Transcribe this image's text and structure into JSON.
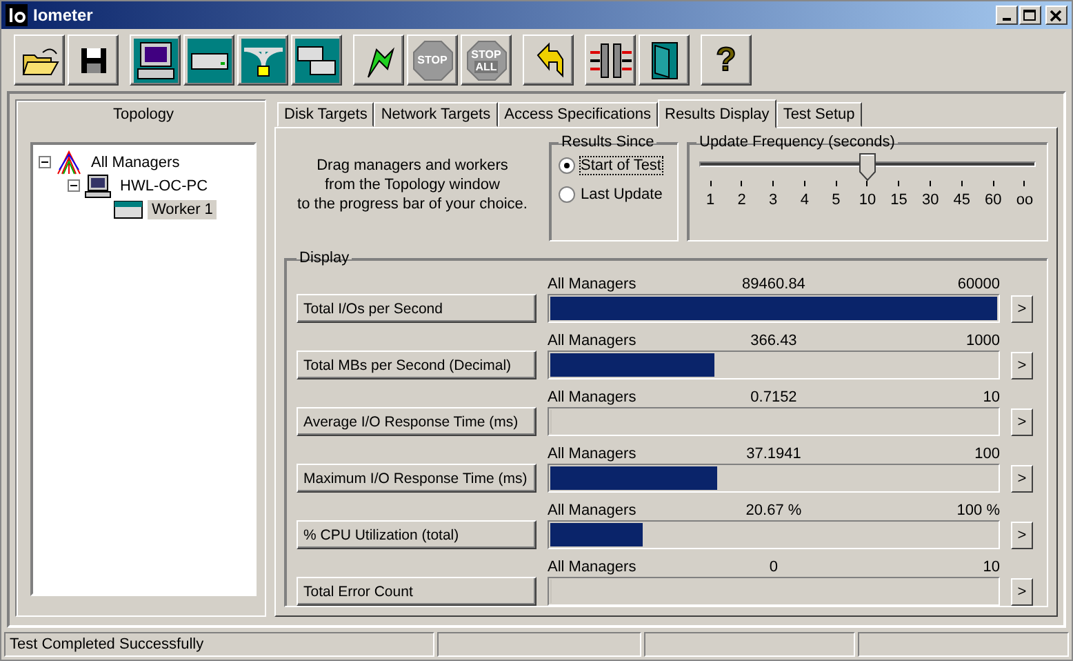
{
  "window": {
    "title": "Iometer",
    "controls": [
      {
        "kind": "minimize"
      },
      {
        "kind": "maximize"
      },
      {
        "kind": "close"
      }
    ]
  },
  "toolbar": [
    {
      "buttons": [
        {
          "kind": "open"
        },
        {
          "kind": "save"
        }
      ]
    },
    {
      "buttons": [
        {
          "kind": "manager"
        },
        {
          "kind": "disk"
        },
        {
          "kind": "network"
        },
        {
          "kind": "copy"
        }
      ]
    },
    {
      "buttons": [
        {
          "kind": "start"
        },
        {
          "kind": "stop",
          "label": "STOP"
        },
        {
          "kind": "stopall",
          "label": "STOP",
          "sublabel": "ALL"
        }
      ]
    },
    {
      "buttons": [
        {
          "kind": "reset"
        }
      ]
    },
    {
      "buttons": [
        {
          "kind": "disconnect"
        },
        {
          "kind": "exit"
        }
      ]
    },
    {
      "buttons": [
        {
          "kind": "help",
          "label": "?"
        }
      ]
    }
  ],
  "topology": {
    "title": "Topology",
    "tree": [
      {
        "label": "All Managers",
        "kind": "managers",
        "expanded": true,
        "selected": false,
        "children": [
          {
            "label": "HWL-OC-PC",
            "kind": "computer",
            "expanded": true,
            "selected": false,
            "children": [
              {
                "label": "Worker 1",
                "kind": "worker",
                "selected": true
              }
            ]
          }
        ]
      }
    ]
  },
  "tabs": [
    {
      "label": "Disk Targets",
      "selected": false
    },
    {
      "label": "Network Targets",
      "selected": false
    },
    {
      "label": "Access Specifications",
      "selected": false
    },
    {
      "label": "Results Display",
      "selected": true
    },
    {
      "label": "Test Setup",
      "selected": false
    }
  ],
  "instructions": "Drag managers and workers\nfrom the Topology window\nto the progress bar of your choice.",
  "results_since": {
    "title": "Results Since",
    "options": [
      {
        "label": "Start of Test",
        "selected": true
      },
      {
        "label": "Last Update",
        "selected": false
      }
    ]
  },
  "update_frequency": {
    "title": "Update Frequency (seconds)",
    "level": 0.5,
    "ticks": [
      "1",
      "2",
      "3",
      "4",
      "5",
      "10",
      "15",
      "30",
      "45",
      "60",
      "oo"
    ]
  },
  "display": {
    "title": "Display",
    "rows": [
      {
        "name": "Total I/Os per Second",
        "manager": "All Managers",
        "value": "89460.84",
        "max": "60000",
        "level": 1.0,
        "arrow": ">"
      },
      {
        "name": "Total MBs per Second (Decimal)",
        "manager": "All Managers",
        "value": "366.43",
        "max": "1000",
        "level": 0.366,
        "arrow": ">"
      },
      {
        "name": "Average I/O Response Time (ms)",
        "manager": "All Managers",
        "value": "0.7152",
        "max": "10",
        "level": 0.0,
        "arrow": ">"
      },
      {
        "name": "Maximum I/O Response Time (ms)",
        "manager": "All Managers",
        "value": "37.1941",
        "max": "100",
        "level": 0.372,
        "arrow": ">"
      },
      {
        "name": "% CPU Utilization (total)",
        "manager": "All Managers",
        "value": "20.67 %",
        "max": "100 %",
        "level": 0.207,
        "arrow": ">"
      },
      {
        "name": "Total Error Count",
        "manager": "All Managers",
        "value": "0",
        "max": "10",
        "level": 0.0,
        "arrow": ">"
      }
    ]
  },
  "status_bar": {
    "text": "Test Completed Successfully"
  }
}
